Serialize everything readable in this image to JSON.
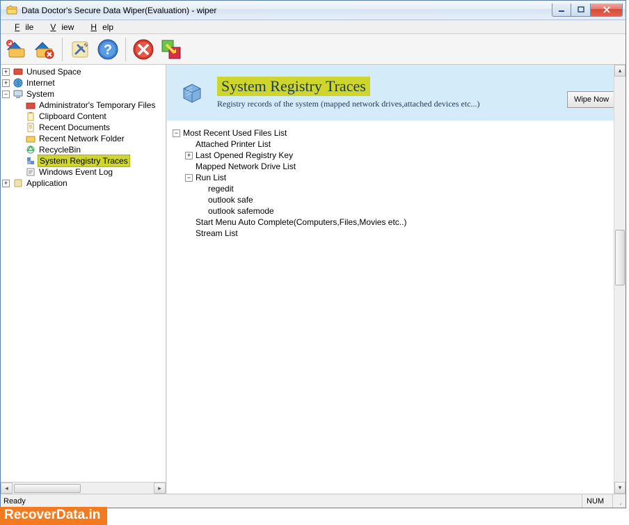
{
  "window": {
    "title": "Data Doctor's Secure Data Wiper(Evaluation) - wiper"
  },
  "menu": {
    "file": "File",
    "view": "View",
    "help": "Help"
  },
  "sidebar": {
    "unused_space": "Unused Space",
    "internet": "Internet",
    "system": "System",
    "admin_temp": "Administrator's Temporary Files",
    "clipboard": "Clipboard Content",
    "recent_docs": "Recent Documents",
    "recent_net": "Recent Network Folder",
    "recyclebin": "RecycleBin",
    "registry_traces": "System Registry Traces",
    "eventlog": "Windows Event Log",
    "application": "Application"
  },
  "header": {
    "title": "System Registry Traces",
    "subtitle": "Registry records of the system (mapped network drives,attached devices etc...)",
    "wipe_btn": "Wipe Now"
  },
  "content": {
    "mru": "Most Recent Used Files List",
    "printer": "Attached Printer List",
    "lastreg": "Last Opened Registry Key",
    "mapped": "Mapped Network Drive List",
    "runlist": "Run List",
    "regedit": "regedit",
    "outlook_safe": "outlook safe",
    "outlook_safemode": "outlook safemode",
    "startmenu": "Start Menu Auto Complete(Computers,Files,Movies etc..)",
    "stream": "Stream List"
  },
  "status": {
    "ready": "Ready",
    "num": "NUM"
  },
  "watermark": "RecoverData.in"
}
